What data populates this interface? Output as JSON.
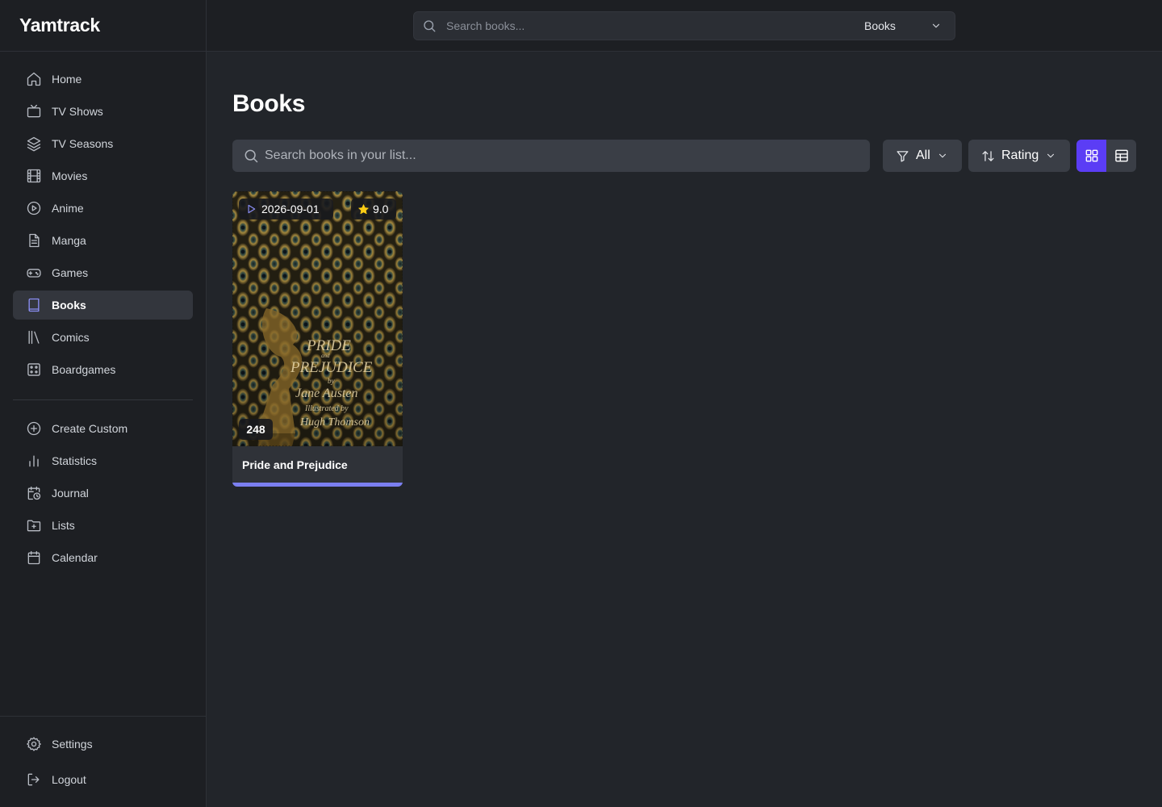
{
  "app": {
    "title": "Yamtrack"
  },
  "topbar": {
    "search_placeholder": "Search books...",
    "type_select": "Books"
  },
  "sidebar": {
    "items": [
      {
        "label": "Home",
        "icon": "home-icon"
      },
      {
        "label": "TV Shows",
        "icon": "tv-icon"
      },
      {
        "label": "TV Seasons",
        "icon": "layers-icon"
      },
      {
        "label": "Movies",
        "icon": "film-icon"
      },
      {
        "label": "Anime",
        "icon": "play-circle-icon"
      },
      {
        "label": "Manga",
        "icon": "document-icon"
      },
      {
        "label": "Games",
        "icon": "gamepad-icon"
      },
      {
        "label": "Books",
        "icon": "book-icon",
        "active": true
      },
      {
        "label": "Comics",
        "icon": "library-icon"
      },
      {
        "label": "Boardgames",
        "icon": "dice-icon"
      }
    ],
    "tools": [
      {
        "label": "Create Custom",
        "icon": "plus-circle-icon"
      },
      {
        "label": "Statistics",
        "icon": "bar-chart-icon"
      },
      {
        "label": "Journal",
        "icon": "calendar-clock-icon"
      },
      {
        "label": "Lists",
        "icon": "folder-plus-icon"
      },
      {
        "label": "Calendar",
        "icon": "calendar-icon"
      }
    ],
    "bottom": [
      {
        "label": "Settings",
        "icon": "gear-icon"
      },
      {
        "label": "Logout",
        "icon": "logout-icon"
      }
    ]
  },
  "main": {
    "title": "Books",
    "list_search_placeholder": "Search books in your list...",
    "filter_label": "All",
    "sort_label": "Rating",
    "view_mode": "grid"
  },
  "cards": [
    {
      "title": "Pride and Prejudice",
      "date": "2026-09-01",
      "rating": "9.0",
      "count": "248",
      "progress_fraction": 1.0
    }
  ],
  "colors": {
    "accent": "#5b3df5",
    "progress": "#7b7ff0",
    "star": "#facc15"
  }
}
